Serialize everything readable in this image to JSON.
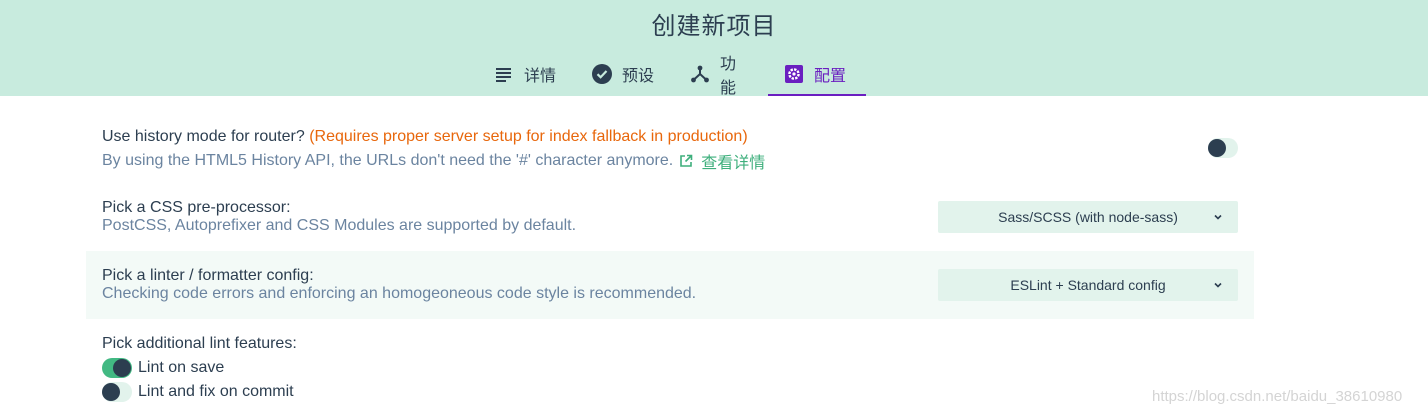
{
  "header": {
    "title": "创建新项目",
    "tabs": [
      {
        "label": "详情",
        "icon": "list-icon"
      },
      {
        "label": "预设",
        "icon": "check-circle-icon"
      },
      {
        "label": "功能",
        "icon": "fork-icon"
      },
      {
        "label": "配置",
        "icon": "gear-icon",
        "active": true
      }
    ]
  },
  "router": {
    "label": "Use history mode for router?",
    "warning": "(Requires proper server setup for index fallback in production)",
    "description": "By using the HTML5 History API, the URLs don't need the '#' character anymore.",
    "link_label": "查看详情",
    "enabled": false
  },
  "css": {
    "label": "Pick a CSS pre-processor:",
    "description": "PostCSS, Autoprefixer and CSS Modules are supported by default.",
    "selected": "Sass/SCSS (with node-sass)"
  },
  "linter": {
    "label": "Pick a linter / formatter config:",
    "description": "Checking code errors and enforcing an homogeoneous code style is recommended.",
    "selected": "ESLint + Standard config"
  },
  "lint_features": {
    "label": "Pick additional lint features:",
    "options": [
      {
        "label": "Lint on save",
        "enabled": true
      },
      {
        "label": "Lint and fix on commit",
        "enabled": false
      }
    ]
  },
  "watermark": "https://blog.csdn.net/baidu_38610980",
  "colors": {
    "header_bg": "#c8ebde",
    "accent": "#6a1fc0",
    "warning": "#e8670c",
    "link": "#3eaf7c",
    "toggle_on": "#42b983"
  }
}
